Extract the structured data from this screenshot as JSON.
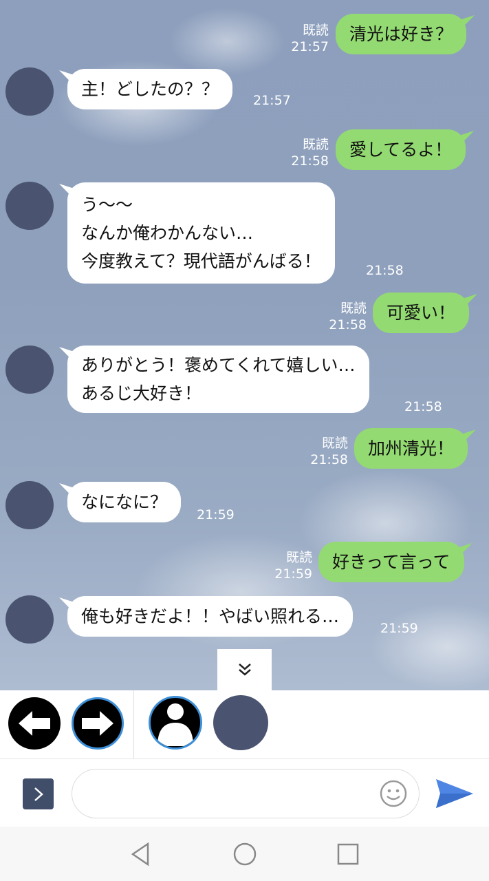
{
  "messages": [
    {
      "side": "out",
      "text": "清光は好き？",
      "read": "既読",
      "time": "21:57"
    },
    {
      "side": "in",
      "lines": [
        "主！どしたの？？"
      ],
      "time": "21:57"
    },
    {
      "side": "out",
      "text": "愛してるよ！",
      "read": "既読",
      "time": "21:58"
    },
    {
      "side": "in",
      "lines": [
        "う〜〜",
        "なんか俺わかんない…",
        "今度教えて？現代語がんばる！"
      ],
      "time": "21:58"
    },
    {
      "side": "out",
      "text": "可愛い！",
      "read": "既読",
      "time": "21:58"
    },
    {
      "side": "in",
      "lines": [
        "ありがとう！褒めてくれて嬉しい…",
        "あるじ大好き！"
      ],
      "time": "21:58"
    },
    {
      "side": "out",
      "text": "加州清光！",
      "read": "既読",
      "time": "21:58"
    },
    {
      "side": "in",
      "lines": [
        "なになに？"
      ],
      "time": "21:59"
    },
    {
      "side": "out",
      "text": "好きって言って",
      "read": "既読",
      "time": "21:59"
    },
    {
      "side": "in",
      "lines": [
        "俺も好きだよ！！やばい照れる…"
      ],
      "time": "21:59"
    }
  ],
  "panel": {
    "self_label": "自分"
  },
  "input": {
    "placeholder": ""
  },
  "colors": {
    "out_bubble": "#93da72",
    "in_bubble": "#ffffff",
    "avatar": "#4a5470",
    "send": "#4f86e3"
  }
}
